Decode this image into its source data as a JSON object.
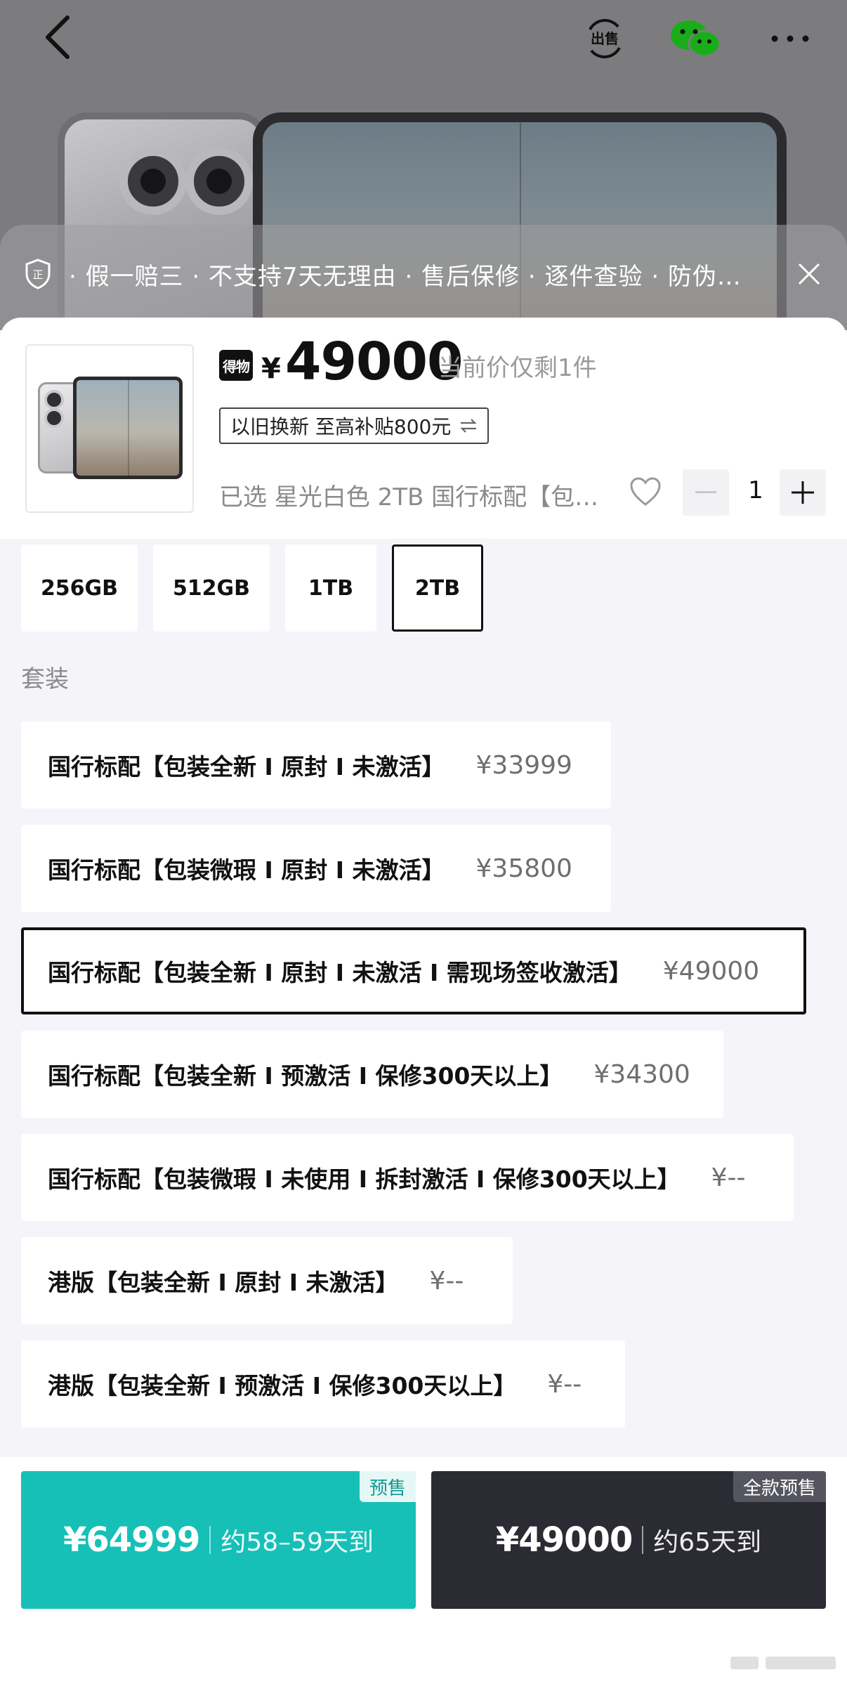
{
  "guarantee": {
    "text": "· 假一赔三 · 不支持7天无理由 · 售后保修 · 逐件查验 · 防伪…"
  },
  "product": {
    "badge": "得物",
    "price_symbol": "¥",
    "price": "49000",
    "price_note": "当前价仅剩1件",
    "tradein_label": "以旧换新 至高补贴800元",
    "selected_text": "已选 星光白色 2TB 国行标配【包…",
    "quantity": "1"
  },
  "storage": {
    "options": [
      "256GB",
      "512GB",
      "1TB",
      "2TB"
    ],
    "selected": "2TB"
  },
  "packages": {
    "section_label": "套装",
    "items": [
      {
        "name": "国行标配【包装全新 I 原封 I 未激活】",
        "price": "¥33999"
      },
      {
        "name": "国行标配【包装微瑕 I 原封 I 未激活】",
        "price": "¥35800"
      },
      {
        "name": "国行标配【包装全新 I 原封 I 未激活 I 需现场签收激活】",
        "price": "¥49000"
      },
      {
        "name": "国行标配【包装全新 I 预激活 I 保修300天以上】",
        "price": "¥34300"
      },
      {
        "name": "国行标配【包装微瑕 I 未使用 I 拆封激活 I 保修300天以上】",
        "price": "¥--"
      },
      {
        "name": "港版【包装全新 I 原封 I 未激活】",
        "price": "¥--"
      },
      {
        "name": "港版【包装全新 I 预激活 I 保修300天以上】",
        "price": "¥--"
      }
    ],
    "selected_index": 2
  },
  "bottom": {
    "presale": {
      "tag": "预售",
      "price": "¥64999",
      "eta": "约58–59天到"
    },
    "full_presale": {
      "tag": "全款预售",
      "price": "¥49000",
      "eta": "约65天到"
    }
  },
  "icons": {
    "back": "back-chevron-icon",
    "sell": "sell-icon",
    "share": "wechat-icon",
    "more": "more-icon",
    "guarantee": "shield-icon",
    "close": "close-icon",
    "heart": "heart-icon",
    "minus": "minus-icon",
    "plus": "plus-icon",
    "swap": "swap-icon"
  },
  "colors": {
    "presale_button": "#16c0b7",
    "full_presale_button": "#2b2b33",
    "wechat": "#1aad19"
  }
}
